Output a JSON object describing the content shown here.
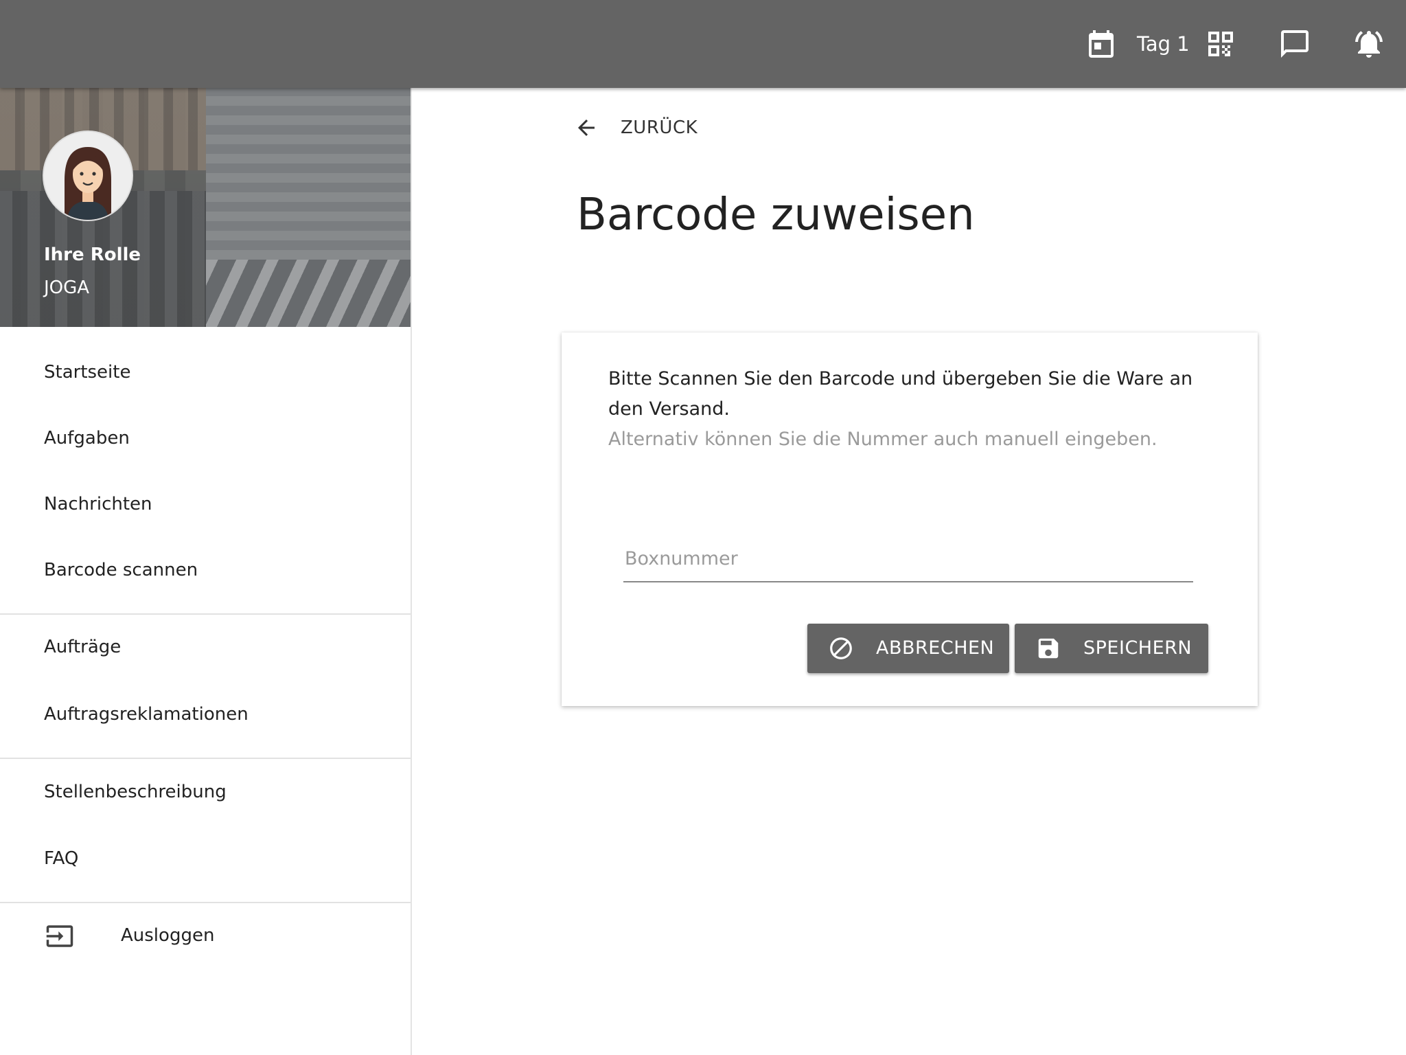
{
  "appbar": {
    "day_label": "Tag 1",
    "icons": [
      "calendar-icon",
      "qr-code-icon",
      "message-icon",
      "notification-bell-icon"
    ]
  },
  "sidebar": {
    "profile": {
      "role_title": "Ihre Rolle",
      "role_name": "JOGA"
    },
    "groups": [
      {
        "items": [
          {
            "label": "Startseite"
          },
          {
            "label": "Aufgaben"
          },
          {
            "label": "Nachrichten"
          },
          {
            "label": "Barcode scannen"
          }
        ]
      },
      {
        "items": [
          {
            "label": "Aufträge"
          },
          {
            "label": "Auftragsreklamationen"
          }
        ]
      },
      {
        "items": [
          {
            "label": "Stellenbeschreibung"
          },
          {
            "label": "FAQ"
          }
        ]
      }
    ],
    "logout": {
      "label": "Ausloggen",
      "icon": "logout-icon"
    }
  },
  "main": {
    "back_label": "ZURÜCK",
    "title": "Barcode zuweisen",
    "card": {
      "instruction": "Bitte Scannen Sie den Barcode und übergeben Sie die Ware an den Versand.",
      "hint": "Alternativ können Sie die Nummer auch manuell eingeben.",
      "input": {
        "placeholder": "Boxnummer",
        "value": ""
      },
      "cancel_label": "ABBRECHEN",
      "save_label": "SPEICHERN"
    }
  },
  "colors": {
    "appbar": "#646464",
    "button": "#646464",
    "hint": "#9a9a9a"
  }
}
